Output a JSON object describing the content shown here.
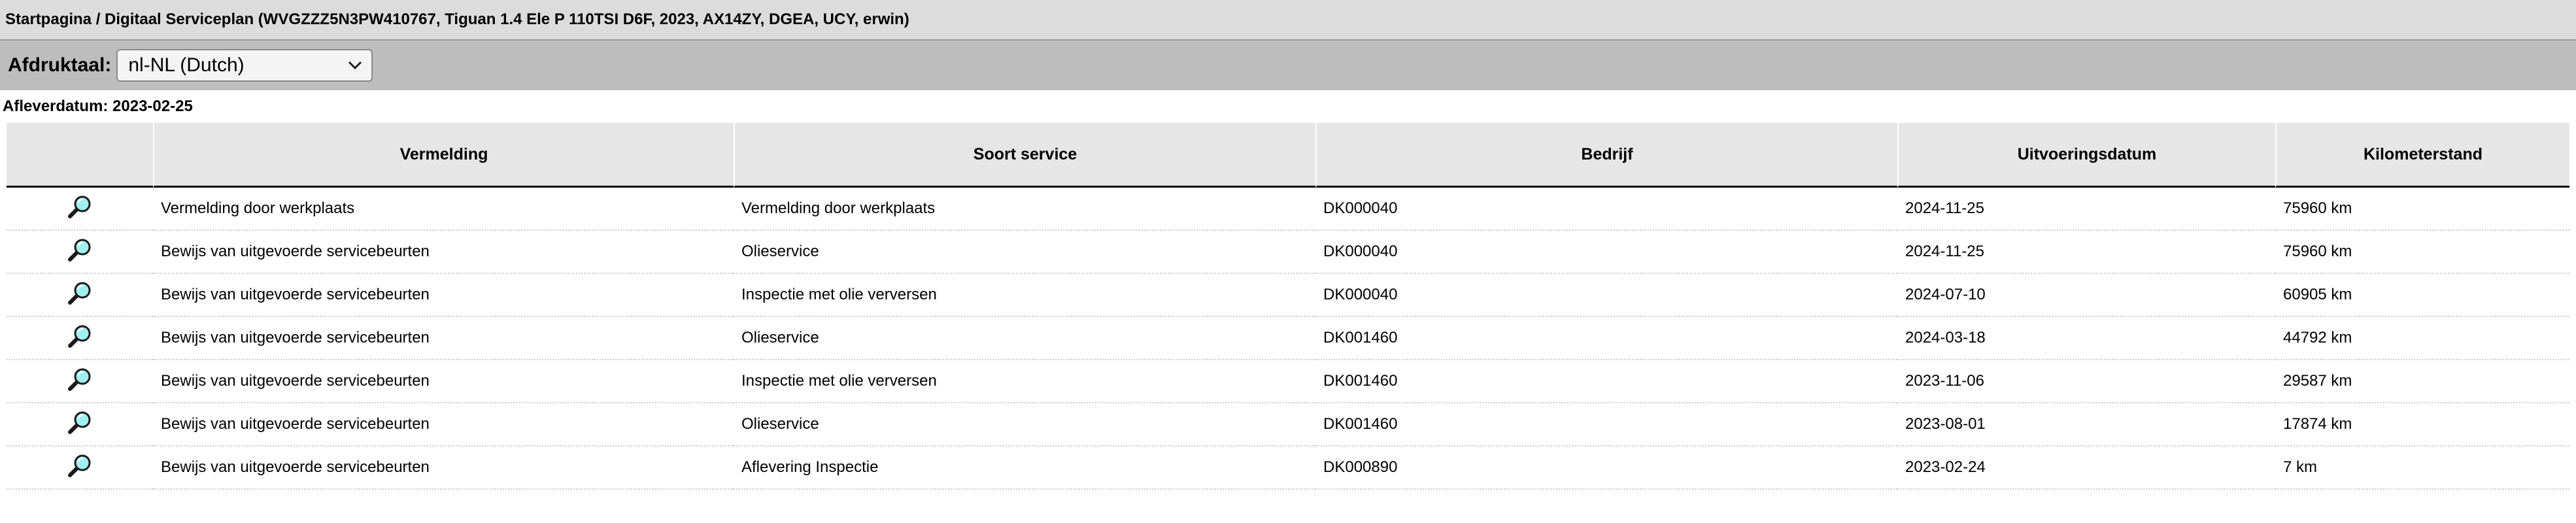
{
  "breadcrumb": "Startpagina / Digitaal Serviceplan (WVGZZZ5N3PW410767, Tiguan 1.4 Ele P 110TSI D6F, 2023, AX14ZY, DGEA, UCY, erwin)",
  "language": {
    "label": "Afdruktaal:",
    "selected": "nl-NL (Dutch)"
  },
  "delivery_date": "Afleverdatum: 2023-02-25",
  "table": {
    "columns": [
      "",
      "Vermelding",
      "Soort service",
      "Bedrijf",
      "Uitvoeringsdatum",
      "Kilometerstand"
    ],
    "rows": [
      {
        "vermelding": "Vermelding door werkplaats",
        "soort": "Vermelding door werkplaats",
        "bedrijf": "DK000040",
        "datum": "2024-11-25",
        "km": "75960 km"
      },
      {
        "vermelding": "Bewijs van uitgevoerde servicebeurten",
        "soort": "Olieservice",
        "bedrijf": "DK000040",
        "datum": "2024-11-25",
        "km": "75960 km"
      },
      {
        "vermelding": "Bewijs van uitgevoerde servicebeurten",
        "soort": "Inspectie met olie verversen",
        "bedrijf": "DK000040",
        "datum": "2024-07-10",
        "km": "60905 km"
      },
      {
        "vermelding": "Bewijs van uitgevoerde servicebeurten",
        "soort": "Olieservice",
        "bedrijf": "DK001460",
        "datum": "2024-03-18",
        "km": "44792 km"
      },
      {
        "vermelding": "Bewijs van uitgevoerde servicebeurten",
        "soort": "Inspectie met olie verversen",
        "bedrijf": "DK001460",
        "datum": "2023-11-06",
        "km": "29587 km"
      },
      {
        "vermelding": "Bewijs van uitgevoerde servicebeurten",
        "soort": "Olieservice",
        "bedrijf": "DK001460",
        "datum": "2023-08-01",
        "km": "17874 km"
      },
      {
        "vermelding": "Bewijs van uitgevoerde servicebeurten",
        "soort": "Aflevering Inspectie",
        "bedrijf": "DK000890",
        "datum": "2023-02-24",
        "km": "7 km"
      }
    ]
  },
  "icons": {
    "row_action": "magnifier-icon",
    "dropdown": "chevron-down-icon"
  }
}
